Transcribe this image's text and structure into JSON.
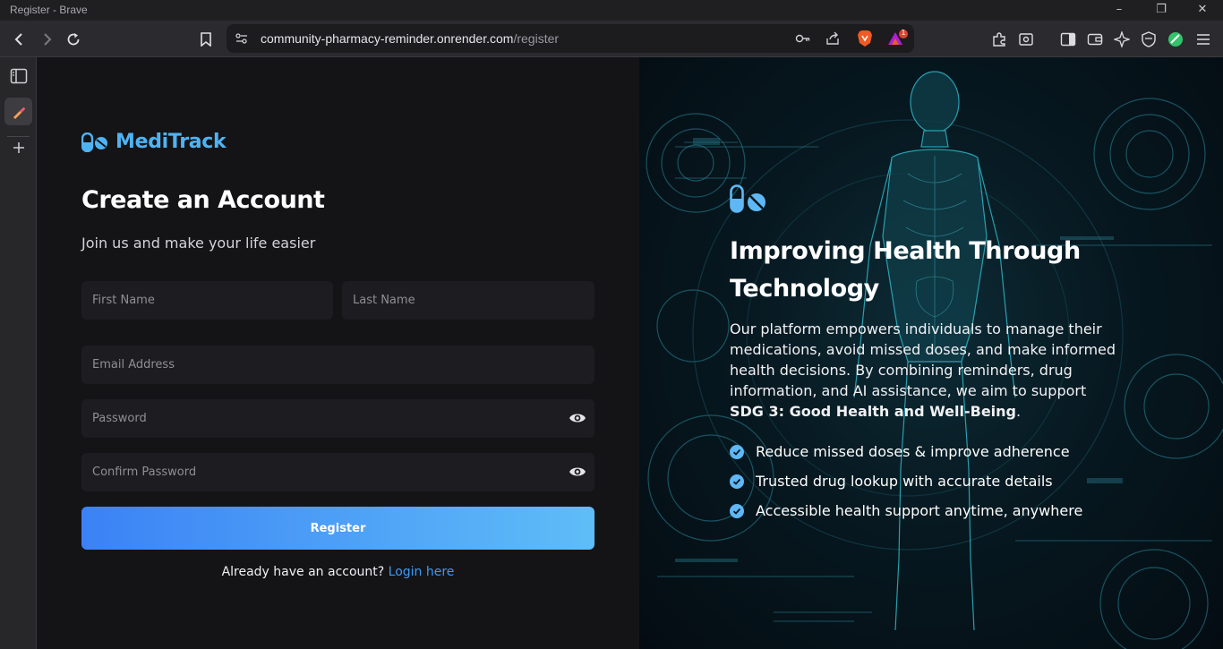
{
  "window": {
    "title": "Register - Brave"
  },
  "browser": {
    "url_host": "community-pharmacy-reminder.onrender.com",
    "url_path": "/register",
    "notification_badge": "1"
  },
  "brand": {
    "name": "MediTrack",
    "accent": "#4fb3f3"
  },
  "form": {
    "heading": "Create an Account",
    "subheading": "Join us and make your life easier",
    "first_name_placeholder": "First Name",
    "last_name_placeholder": "Last Name",
    "email_placeholder": "Email Address",
    "password_placeholder": "Password",
    "confirm_password_placeholder": "Confirm Password",
    "submit_label": "Register",
    "login_prompt": "Already have an account?",
    "login_link": "Login here"
  },
  "hero": {
    "title": "Improving Health Through Technology",
    "text_intro": "Our platform empowers individuals to manage their medications, avoid missed doses, and make informed health decisions. By combining reminders, drug information, and AI assistance, we aim to support ",
    "text_bold": "SDG 3: Good Health and Well-Being",
    "text_end": ".",
    "bullets": [
      "Reduce missed doses & improve adherence",
      "Trusted drug lookup with accurate details",
      "Accessible health support anytime, anywhere"
    ]
  },
  "colors": {
    "button_start": "#3b82f6",
    "button_end": "#5fbdf7",
    "link": "#3b9af6",
    "check": "#5fb8f5"
  }
}
